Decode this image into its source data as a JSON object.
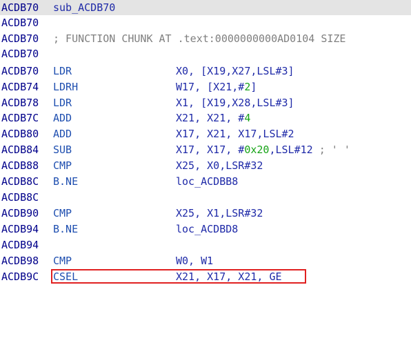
{
  "lines": [
    {
      "address": "ACDB70",
      "label": "sub_ACDB70"
    },
    {
      "address": "ACDB70"
    },
    {
      "address": "ACDB70",
      "comment": "; FUNCTION CHUNK AT .text:0000000000AD0104 SIZE"
    },
    {
      "address": "ACDB70"
    },
    {
      "address": "ACDB70",
      "mnemonic": "LDR",
      "operands": "X0, [X19,X27,LSL#3]"
    },
    {
      "address": "ACDB74",
      "mnemonic": "LDRH",
      "operands_pre": "W17, [X21,#",
      "operands_num": "2",
      "operands_post": "]"
    },
    {
      "address": "ACDB78",
      "mnemonic": "LDR",
      "operands": "X1, [X19,X28,LSL#3]"
    },
    {
      "address": "ACDB7C",
      "mnemonic": "ADD",
      "operands_pre": "X21, X21, #",
      "operands_num": "4"
    },
    {
      "address": "ACDB80",
      "mnemonic": "ADD",
      "operands": "X17, X21, X17,LSL#2"
    },
    {
      "address": "ACDB84",
      "mnemonic": "SUB",
      "operands_pre": "X17, X17, #",
      "operands_num": "0x20",
      "operands_post": ",LSL#12",
      "operands_comment": " ; ' '"
    },
    {
      "address": "ACDB88",
      "mnemonic": "CMP",
      "operands": "X25, X0,LSR#32"
    },
    {
      "address": "ACDB8C",
      "mnemonic": "B.NE",
      "operands": "loc_ACDBB8"
    },
    {
      "address": "ACDB8C"
    },
    {
      "address": "ACDB90",
      "mnemonic": "CMP",
      "operands": "X25, X1,LSR#32"
    },
    {
      "address": "ACDB94",
      "mnemonic": "B.NE",
      "operands": "loc_ACDBD8"
    },
    {
      "address": "ACDB94"
    },
    {
      "address": "ACDB98",
      "mnemonic": "CMP",
      "operands": "W0, W1"
    },
    {
      "address": "ACDB9C",
      "mnemonic": "CSEL",
      "operands": "X21, X17, X21, GE"
    }
  ],
  "colors": {
    "address": "#00008a",
    "mnemonic": "#1f4fb0",
    "operand": "#1f2aa8",
    "number": "#16a316",
    "comment": "#7f7f7f",
    "highlight": "#e4e4e4",
    "selection": "#e02020"
  }
}
